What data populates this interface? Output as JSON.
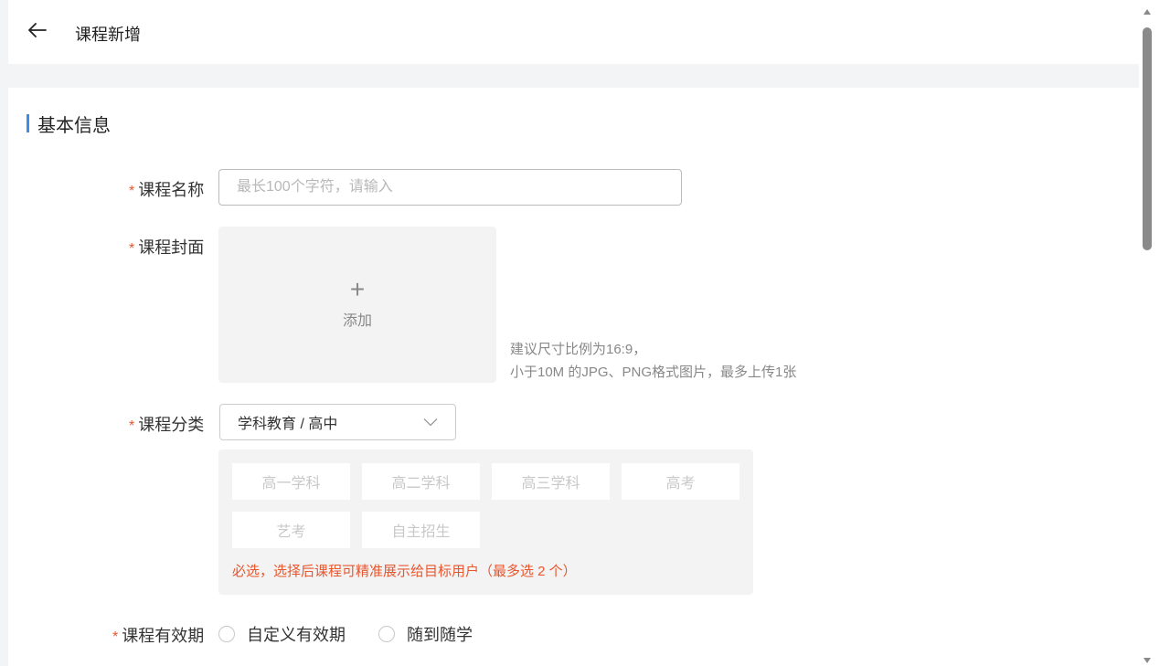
{
  "header": {
    "back_icon": "arrow-left-icon",
    "title": "课程新增"
  },
  "section": {
    "title": "基本信息",
    "accent_color": "#3a8ee6"
  },
  "form": {
    "required_mark": "*",
    "required_color": "#e8562d",
    "course_name": {
      "label": "课程名称",
      "value": "",
      "placeholder": "最长100个字符，请输入"
    },
    "cover": {
      "label": "课程封面",
      "upload_icon": "plus-icon",
      "upload_plus": "+",
      "upload_label": "添加",
      "hint_line1": "建议尺寸比例为16:9，",
      "hint_line2": "小于10M 的JPG、PNG格式图片，最多上传1张"
    },
    "category": {
      "label": "课程分类",
      "selected": "学科教育 / 高中",
      "dropdown_icon": "chevron-down-icon",
      "tags": [
        "高一学科",
        "高二学科",
        "高三学科",
        "高考",
        "艺考",
        "自主招生"
      ],
      "hint": "必选，选择后课程可精准展示给目标用户（最多选 2 个）"
    },
    "validity": {
      "label": "课程有效期",
      "options": [
        "自定义有效期",
        "随到随学"
      ]
    }
  }
}
